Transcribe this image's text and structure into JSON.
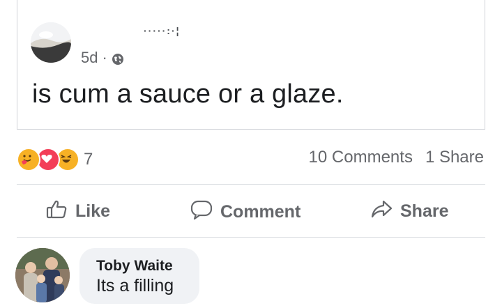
{
  "post": {
    "author_name": "·····:·¦",
    "timestamp": "5d",
    "separator": "·",
    "privacy_icon": "globe-icon",
    "text": "is cum a sauce or a glaze."
  },
  "reactions": {
    "icons": [
      "care-reaction-icon",
      "love-reaction-icon",
      "haha-reaction-icon"
    ],
    "count": "7",
    "comments_count": "10 Comments",
    "shares_count": "1 Share"
  },
  "actions": {
    "like_label": "Like",
    "comment_label": "Comment",
    "share_label": "Share"
  },
  "comment": {
    "author": "Toby Waite",
    "text": "Its a filling"
  },
  "colors": {
    "secondary_text": "#65676b",
    "bubble_bg": "#f0f2f5",
    "love_red": "#f33e58",
    "reaction_yellow": "#f7b125"
  }
}
